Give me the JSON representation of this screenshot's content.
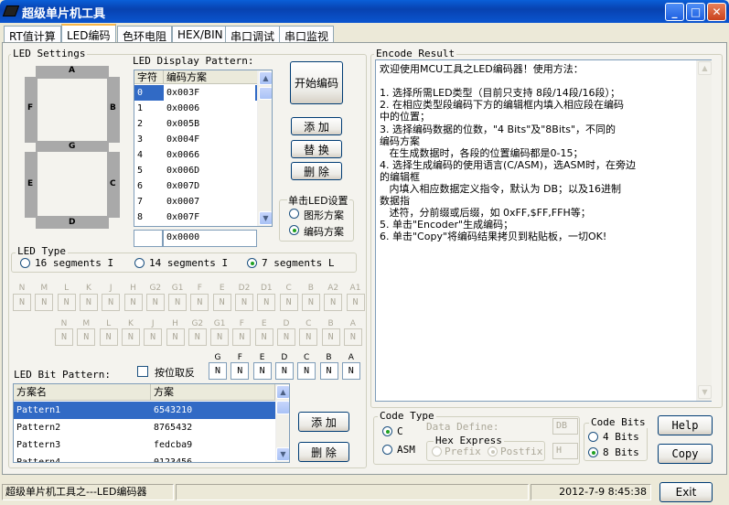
{
  "window": {
    "title": "超级单片机工具",
    "min": "_",
    "max": "□",
    "close": "✕"
  },
  "tabs": [
    "RT值计算",
    "LED编码",
    "色环电阻",
    "HEX/BIN",
    "串口调试",
    "串口监视"
  ],
  "led_settings": {
    "title": "LED Settings",
    "segments": [
      "A",
      "B",
      "C",
      "D",
      "E",
      "F",
      "G"
    ]
  },
  "display_pattern": {
    "title": "LED Display Pattern:",
    "headers": [
      "字符",
      "编码方案"
    ],
    "rows": [
      [
        "0",
        "0x003F"
      ],
      [
        "1",
        "0x0006"
      ],
      [
        "2",
        "0x005B"
      ],
      [
        "3",
        "0x004F"
      ],
      [
        "4",
        "0x0066"
      ],
      [
        "5",
        "0x006D"
      ],
      [
        "6",
        "0x007D"
      ],
      [
        "7",
        "0x0007"
      ],
      [
        "8",
        "0x007F"
      ]
    ],
    "edit_char": "",
    "edit_code": "0x0000"
  },
  "buttons": {
    "start": "开始编码",
    "add": "添 加",
    "replace": "替 换",
    "delete": "删 除",
    "add2": "添 加",
    "delete2": "删 除",
    "help": "Help",
    "copy": "Copy",
    "exit": "Exit"
  },
  "click_led": {
    "title": "单击LED设置",
    "options": [
      "图形方案",
      "编码方案"
    ],
    "selected": 1
  },
  "led_type": {
    "title": "LED Type",
    "options": [
      "16 segments I",
      "14 segments I",
      "7 segments L"
    ],
    "selected": 2
  },
  "bits16": {
    "labels": [
      "N",
      "M",
      "L",
      "K",
      "J",
      "H",
      "G2",
      "G1",
      "F",
      "E",
      "D2",
      "D1",
      "C",
      "B",
      "A2",
      "A1"
    ],
    "values": [
      "N",
      "N",
      "N",
      "N",
      "N",
      "N",
      "N",
      "N",
      "N",
      "N",
      "N",
      "N",
      "N",
      "N",
      "N",
      "N"
    ]
  },
  "bits14": {
    "labels": [
      "N",
      "M",
      "L",
      "K",
      "J",
      "H",
      "G2",
      "G1",
      "F",
      "E",
      "D",
      "C",
      "B",
      "A"
    ],
    "values": [
      "N",
      "N",
      "N",
      "N",
      "N",
      "N",
      "N",
      "N",
      "N",
      "N",
      "N",
      "N",
      "N",
      "N"
    ]
  },
  "bits7": {
    "labels": [
      "G",
      "F",
      "E",
      "D",
      "C",
      "B",
      "A"
    ],
    "values": [
      "N",
      "N",
      "N",
      "N",
      "N",
      "N",
      "N"
    ]
  },
  "bit_pattern": {
    "title": "LED Bit Pattern:",
    "invert_label": "按位取反",
    "headers": [
      "方案名",
      "方案"
    ],
    "rows": [
      [
        "Pattern1",
        "6543210"
      ],
      [
        "Pattern2",
        "8765432"
      ],
      [
        "Pattern3",
        "fedcba9"
      ],
      [
        "Pattern4",
        "0123456"
      ]
    ]
  },
  "encode_result": {
    "title": "Encode Result",
    "lines": [
      "欢迎使用MCU工具之LED编码器！使用方法：",
      "",
      "1. 选择所需LED类型（目前只支持 8段/14段/16段）；",
      "2. 在相应类型段编码下方的编辑框内填入相应段在编码",
      "中的位置；",
      "3. 选择编码数据的位数，\"4 Bits\"及\"8Bits\"，不同的",
      "编码方案",
      "   在生成数据时，各段的位置编码都是0-15；",
      "4. 选择生成编码的使用语言(C/ASM)，选ASM时，在旁边",
      "的编辑框",
      "   内填入相应数据定义指令，默认为 DB；以及16进制",
      "数据指",
      "   述符，分前缀或后缀，如 0xFF,$FF,FFH等；",
      "5. 单击\"Encoder\"生成编码；",
      "6. 单击\"Copy\"将编码结果拷贝到粘贴板，一切OK!"
    ]
  },
  "code_type": {
    "title": "Code Type",
    "options": [
      "C",
      "ASM"
    ],
    "selected": 0,
    "data_define_label": "Data Define:",
    "data_define_value": "DB",
    "hex_express_title": "Hex Express",
    "hex_options": [
      "Prefix",
      "Postfix"
    ],
    "hex_selected": 1,
    "hex_value": "H"
  },
  "code_bits": {
    "title": "Code Bits",
    "options": [
      "4 Bits",
      "8 Bits"
    ],
    "selected": 1
  },
  "status": {
    "text": "超级单片机工具之---LED编码器",
    "datetime": "2012-7-9 8:45:38"
  }
}
